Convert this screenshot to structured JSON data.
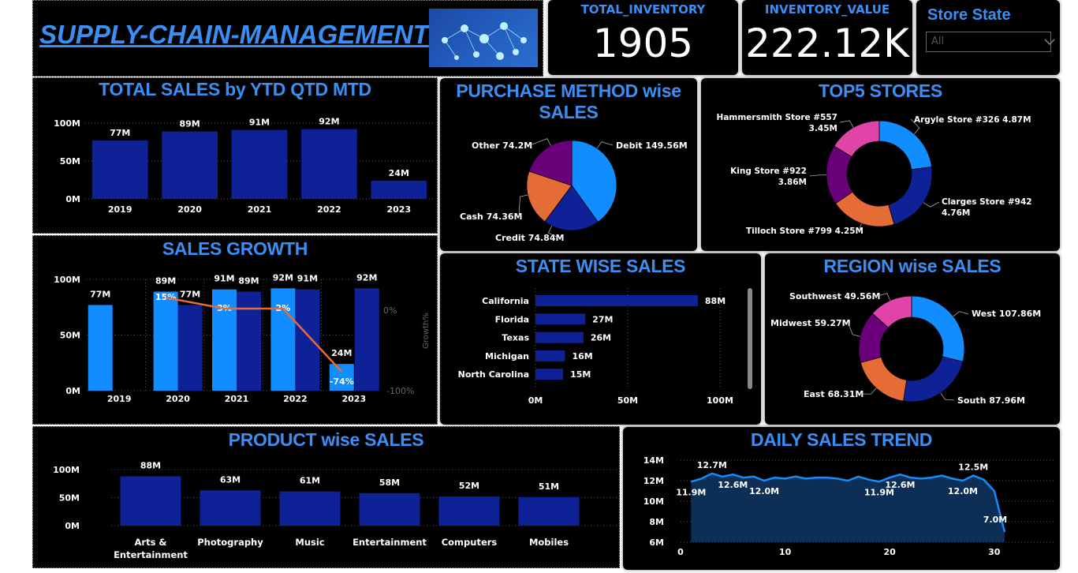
{
  "header": {
    "title": "SUPPLY-CHAIN-MANAGEMENT",
    "logo_icon": "network-icon"
  },
  "kpis": {
    "total_inventory": {
      "label": "TOTAL_INVENTORY",
      "value": "1905"
    },
    "inventory_value": {
      "label": "INVENTORY_VALUE",
      "value": "222.12K"
    }
  },
  "filter": {
    "label": "Store State",
    "selected": "All"
  },
  "colors": {
    "navy": "#0f2196",
    "blue": "#118dff",
    "orange": "#e66c37",
    "purple": "#6b007b",
    "pink": "#e044a7",
    "title": "#3a8ff5"
  },
  "total_sales": {
    "title": "TOTAL SALES by YTD QTD MTD",
    "chart_data": {
      "type": "bar",
      "categories": [
        "2019",
        "2020",
        "2021",
        "2022",
        "2023"
      ],
      "values": [
        77,
        89,
        91,
        92,
        24
      ],
      "data_labels": [
        "77M",
        "89M",
        "91M",
        "92M",
        "24M"
      ],
      "y_ticks": [
        "0M",
        "50M",
        "100M"
      ],
      "ylim": [
        0,
        100
      ]
    }
  },
  "sales_growth": {
    "title": "SALES GROWTH",
    "axis_right_label": "Growth%",
    "chart_data": {
      "type": "bar",
      "categories": [
        "2019",
        "2020",
        "2021",
        "2022",
        "2023"
      ],
      "series": [
        {
          "values": [
            77,
            89,
            91,
            92,
            24
          ],
          "labels": [
            "77M",
            "89M",
            "91M",
            "92M",
            "24M"
          ]
        },
        {
          "values": [
            null,
            77,
            89,
            91,
            92
          ],
          "labels": [
            "",
            "77M",
            "89M",
            "91M",
            "92M"
          ]
        }
      ],
      "growth": [
        null,
        15,
        3,
        2,
        -74
      ],
      "growth_labels": [
        "",
        "15%",
        "3%",
        "2%",
        "-74%"
      ],
      "y_ticks": [
        "0M",
        "50M",
        "100M"
      ],
      "y2_ticks": [
        "0%",
        "-100%"
      ],
      "ylim": [
        0,
        100
      ]
    }
  },
  "purchase_method": {
    "title_line1": "PURCHASE METHOD wise",
    "title_line2": "SALES",
    "chart_data": {
      "type": "pie",
      "labels": [
        "Debit",
        "Credit",
        "Cash",
        "Other"
      ],
      "values": [
        149.56,
        74.84,
        74.36,
        74.2
      ],
      "slice_labels": [
        "Debit 149.56M",
        "Credit 74.84M",
        "Cash 74.36M",
        "Other 74.2M"
      ]
    }
  },
  "top5_stores": {
    "title": "TOP5 STORES",
    "chart_data": {
      "type": "pie",
      "labels": [
        "Argyle Store #326",
        "Clarges Store #942",
        "Tilloch Store #799",
        "King Store #922",
        "Hammersmith Store #557"
      ],
      "values": [
        4.87,
        4.76,
        4.25,
        3.86,
        3.45
      ],
      "label_a": [
        "Argyle Store #326 4.87M",
        "Clarges Store #942",
        "Tilloch Store #799 4.25M",
        "King Store #922",
        "Hammersmith Store #557"
      ],
      "label_b": [
        "",
        "4.76M",
        "",
        "3.86M",
        "3.45M"
      ]
    }
  },
  "state_sales": {
    "title": "STATE WISE SALES",
    "chart_data": {
      "type": "bar",
      "categories": [
        "California",
        "Florida",
        "Texas",
        "Michigan",
        "North Carolina"
      ],
      "values": [
        88,
        27,
        26,
        16,
        15
      ],
      "data_labels": [
        "88M",
        "27M",
        "26M",
        "16M",
        "15M"
      ],
      "x_ticks": [
        "0M",
        "50M",
        "100M"
      ],
      "xlim": [
        0,
        100
      ]
    }
  },
  "region_sales": {
    "title": "REGION wise SALES",
    "chart_data": {
      "type": "pie",
      "labels": [
        "West",
        "South",
        "East",
        "Midwest",
        "Southwest"
      ],
      "values": [
        107.86,
        87.96,
        68.31,
        59.27,
        49.56
      ],
      "slice_labels": [
        "West 107.86M",
        "South 87.96M",
        "East 68.31M",
        "Midwest 59.27M",
        "Southwest 49.56M"
      ]
    }
  },
  "product_sales": {
    "title": "PRODUCT wise SALES",
    "chart_data": {
      "type": "bar",
      "categories": [
        "Arts & Entertainment",
        "Photography",
        "Music",
        "Entertainment",
        "Computers",
        "Mobiles"
      ],
      "cat_line1": [
        "Arts &",
        "Photography",
        "Music",
        "Entertainment",
        "Computers",
        "Mobiles"
      ],
      "cat_line2": [
        "Entertainment",
        "",
        "",
        "",
        "",
        ""
      ],
      "values": [
        88,
        63,
        61,
        58,
        52,
        51
      ],
      "data_labels": [
        "88M",
        "63M",
        "61M",
        "58M",
        "52M",
        "51M"
      ],
      "y_ticks": [
        "0M",
        "50M",
        "100M"
      ],
      "ylim": [
        0,
        100
      ]
    }
  },
  "daily_trend": {
    "title": "DAILY SALES TREND",
    "chart_data": {
      "type": "area",
      "x": [
        1,
        2,
        3,
        4,
        5,
        6,
        7,
        8,
        9,
        10,
        11,
        12,
        13,
        14,
        15,
        16,
        17,
        18,
        19,
        20,
        21,
        22,
        23,
        24,
        25,
        26,
        27,
        28,
        29,
        30,
        31
      ],
      "values": [
        11.9,
        12.2,
        12.7,
        12.4,
        12.6,
        12.3,
        12.4,
        12.0,
        12.3,
        12.2,
        12.4,
        12.2,
        12.3,
        12.3,
        12.2,
        12.0,
        12.4,
        12.1,
        11.9,
        12.3,
        12.6,
        12.3,
        12.2,
        12.3,
        12.5,
        12.2,
        12.0,
        12.5,
        12.1,
        11.0,
        7.0
      ],
      "point_labels": [
        {
          "i": 0,
          "text": "11.9M",
          "pos": "below"
        },
        {
          "i": 2,
          "text": "12.7M",
          "pos": "above"
        },
        {
          "i": 4,
          "text": "12.6M",
          "pos": "below"
        },
        {
          "i": 7,
          "text": "12.0M",
          "pos": "below"
        },
        {
          "i": 18,
          "text": "11.9M",
          "pos": "below"
        },
        {
          "i": 20,
          "text": "12.6M",
          "pos": "below"
        },
        {
          "i": 26,
          "text": "12.0M",
          "pos": "below"
        },
        {
          "i": 27,
          "text": "12.5M",
          "pos": "above"
        },
        {
          "i": 30,
          "text": "7.0M",
          "pos": "above"
        }
      ],
      "y_ticks": [
        "6M",
        "8M",
        "10M",
        "12M",
        "14M"
      ],
      "y_tick_values": [
        6,
        8,
        10,
        12,
        14
      ],
      "x_ticks": [
        "0",
        "10",
        "20",
        "30"
      ],
      "x_tick_values": [
        0,
        10,
        20,
        30
      ],
      "ylim": [
        6,
        14
      ],
      "xlim": [
        0,
        31
      ]
    }
  }
}
